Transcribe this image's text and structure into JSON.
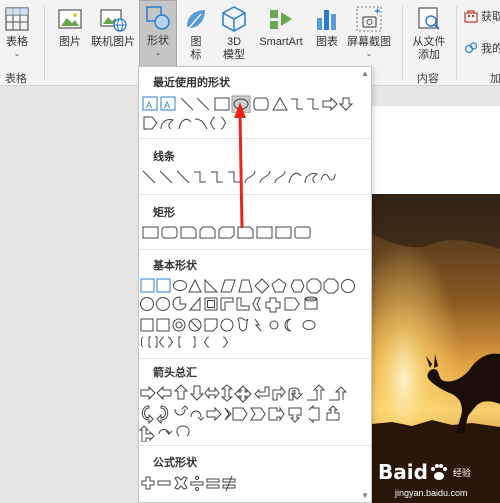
{
  "ribbon": {
    "buttons": [
      {
        "name": "table-button",
        "label": "表格",
        "icon": "table-icon"
      },
      {
        "name": "picture-button",
        "label": "图片",
        "icon": "picture-icon"
      },
      {
        "name": "online-picture-button",
        "label": "联机图片",
        "icon": "online-picture-icon"
      },
      {
        "name": "shapes-button",
        "label": "形状",
        "icon": "shapes-icon",
        "selected": true
      },
      {
        "name": "icons-button",
        "label": "图\n标",
        "icon": "icons-icon"
      },
      {
        "name": "3d-model-button",
        "label": "3D\n模型",
        "icon": "3d-model-icon"
      },
      {
        "name": "smartart-button",
        "label": "SmartArt",
        "icon": "smartart-icon"
      },
      {
        "name": "chart-button",
        "label": "图表",
        "icon": "chart-icon"
      },
      {
        "name": "screenshot-button",
        "label": "屏幕截图",
        "icon": "screenshot-icon"
      },
      {
        "name": "from-file-button",
        "label": "从文件\n添加",
        "icon": "from-file-icon"
      }
    ],
    "groups": {
      "tables": "表格",
      "content": "内容",
      "addin": "加"
    },
    "right_buttons": {
      "get": "获取",
      "mine": "我的"
    }
  },
  "menu": {
    "sections": [
      {
        "title": "最近使用的形状"
      },
      {
        "title": "线条"
      },
      {
        "title": "矩形"
      },
      {
        "title": "基本形状"
      },
      {
        "title": "箭头总汇"
      },
      {
        "title": "公式形状"
      }
    ]
  },
  "watermark": {
    "brand": "Baid",
    "sub": "经验",
    "url": "jingyan.baidu.com"
  },
  "colors": {
    "ribbon_bg": "#f3f3f3",
    "selected_bg": "#c5c5c5",
    "accent_blue": "#2b7cd3",
    "red_arrow": "#e8261b",
    "menu_bg": "#ffffff"
  }
}
